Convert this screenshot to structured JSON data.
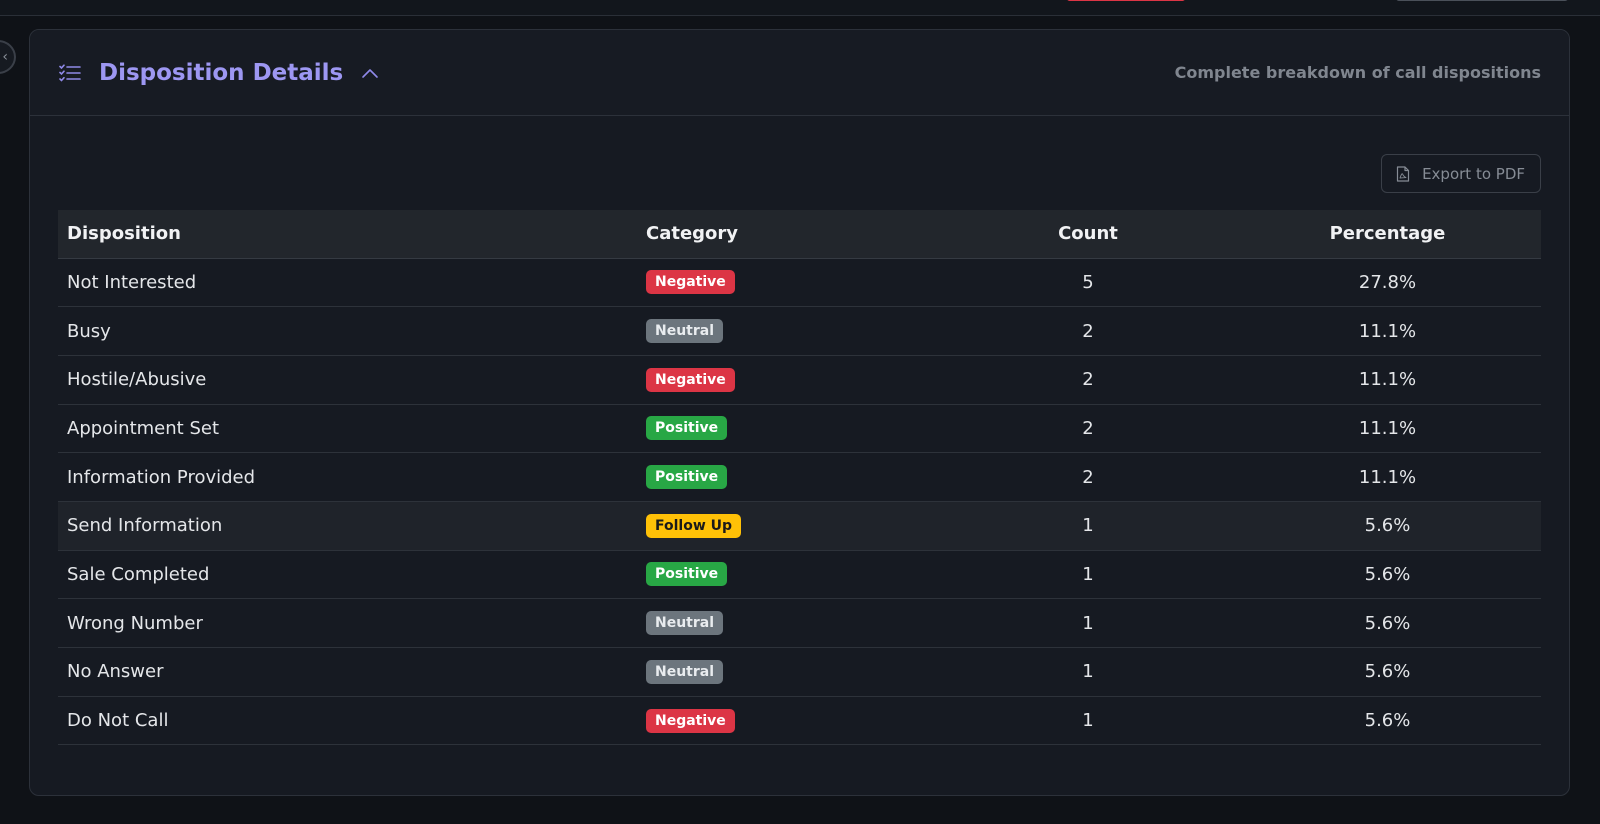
{
  "header": {
    "title": "Disposition Details",
    "subtitle": "Complete breakdown of call dispositions"
  },
  "toolbar": {
    "export_label": "Export to PDF"
  },
  "table": {
    "columns": [
      "Disposition",
      "Category",
      "Count",
      "Percentage"
    ],
    "rows": [
      {
        "disposition": "Not Interested",
        "category": "Negative",
        "count": "5",
        "percentage": "27.8%"
      },
      {
        "disposition": "Busy",
        "category": "Neutral",
        "count": "2",
        "percentage": "11.1%"
      },
      {
        "disposition": "Hostile/Abusive",
        "category": "Negative",
        "count": "2",
        "percentage": "11.1%"
      },
      {
        "disposition": "Appointment Set",
        "category": "Positive",
        "count": "2",
        "percentage": "11.1%"
      },
      {
        "disposition": "Information Provided",
        "category": "Positive",
        "count": "2",
        "percentage": "11.1%"
      },
      {
        "disposition": "Send Information",
        "category": "Follow Up",
        "count": "1",
        "percentage": "5.6%"
      },
      {
        "disposition": "Sale Completed",
        "category": "Positive",
        "count": "1",
        "percentage": "5.6%"
      },
      {
        "disposition": "Wrong Number",
        "category": "Neutral",
        "count": "1",
        "percentage": "5.6%"
      },
      {
        "disposition": "No Answer",
        "category": "Neutral",
        "count": "1",
        "percentage": "5.6%"
      },
      {
        "disposition": "Do Not Call",
        "category": "Negative",
        "count": "1",
        "percentage": "5.6%"
      }
    ]
  },
  "category_colors": {
    "Negative": {
      "bg": "#dc3545",
      "fg": "#ffffff"
    },
    "Neutral": {
      "bg": "#6c757d",
      "fg": "#e9ecef"
    },
    "Positive": {
      "bg": "#28a745",
      "fg": "#ffffff"
    },
    "Follow Up": {
      "bg": "#ffc107",
      "fg": "#1a1a1a"
    }
  },
  "icons": {
    "header_icon": "list-check-icon",
    "collapse_icon": "chevron-up-icon",
    "export_icon": "file-pdf-icon",
    "edge_icon": "chevron-left-icon"
  },
  "colors": {
    "accent": "#9d97f2",
    "card_bg": "#161a22",
    "page_bg": "#0f1217"
  }
}
